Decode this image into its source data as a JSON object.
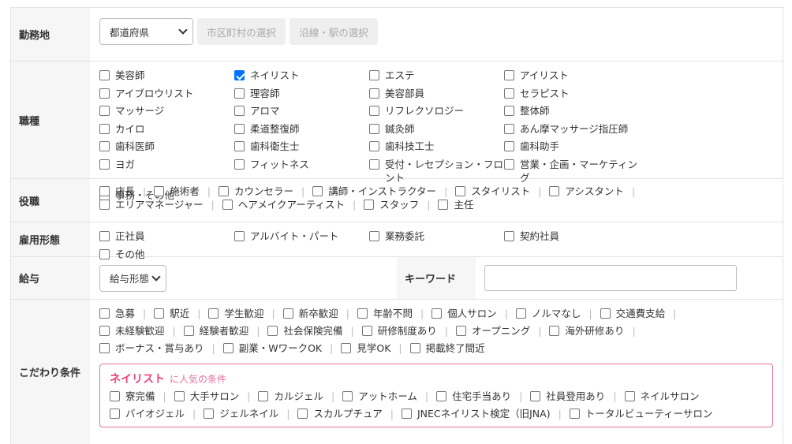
{
  "location": {
    "label": "勤務地",
    "prefecture_select": "都道府県",
    "city_button": "市区町村の選択",
    "station_button": "沿線・駅の選択"
  },
  "occupation": {
    "label": "職種",
    "items": [
      {
        "label": "美容師",
        "checked": false
      },
      {
        "label": "ネイリスト",
        "checked": true
      },
      {
        "label": "エステ",
        "checked": false
      },
      {
        "label": "アイリスト",
        "checked": false
      },
      {
        "label": "アイブロウリスト",
        "checked": false
      },
      {
        "label": "理容師",
        "checked": false
      },
      {
        "label": "美容部員",
        "checked": false
      },
      {
        "label": "セラピスト",
        "checked": false
      },
      {
        "label": "マッサージ",
        "checked": false
      },
      {
        "label": "アロマ",
        "checked": false
      },
      {
        "label": "リフレクソロジー",
        "checked": false
      },
      {
        "label": "整体師",
        "checked": false
      },
      {
        "label": "カイロ",
        "checked": false
      },
      {
        "label": "柔道整復師",
        "checked": false
      },
      {
        "label": "鍼灸師",
        "checked": false
      },
      {
        "label": "あん摩マッサージ指圧師",
        "checked": false
      },
      {
        "label": "歯科医師",
        "checked": false
      },
      {
        "label": "歯科衛生士",
        "checked": false
      },
      {
        "label": "歯科技工士",
        "checked": false
      },
      {
        "label": "歯科助手",
        "checked": false
      },
      {
        "label": "ヨガ",
        "checked": false
      },
      {
        "label": "フィットネス",
        "checked": false
      },
      {
        "label": "受付・レセプション・フロント",
        "checked": false
      },
      {
        "label": "営業・企画・マーケティング",
        "checked": false
      },
      {
        "label": "事務・その他",
        "checked": false
      }
    ]
  },
  "position": {
    "label": "役職",
    "line1": [
      "店長",
      "施術者",
      "カウンセラー",
      "講師・インストラクター",
      "スタイリスト",
      "アシスタント"
    ],
    "line2": [
      "エリアマネージャー",
      "ヘアメイクアーティスト",
      "スタッフ",
      "主任"
    ]
  },
  "employment": {
    "label": "雇用形態",
    "items": [
      "正社員",
      "アルバイト・パート",
      "業務委託",
      "契約社員",
      "その他"
    ]
  },
  "salary": {
    "label": "給与",
    "select": "給与形態",
    "keyword_label": "キーワード",
    "keyword_value": ""
  },
  "conditions": {
    "label": "こだわり条件",
    "line1": [
      "急募",
      "駅近",
      "学生歓迎",
      "新卒歓迎",
      "年齢不問",
      "個人サロン",
      "ノルマなし",
      "交通費支給"
    ],
    "line2": [
      "未経験歓迎",
      "経験者歓迎",
      "社会保険完備",
      "研修制度あり",
      "オープニング",
      "海外研修あり"
    ],
    "line3": [
      "ボーナス・賞与あり",
      "副業・WワークOK",
      "見学OK",
      "掲載終了間近"
    ],
    "popular": {
      "title": "ネイリスト",
      "subtitle": "に人気の条件",
      "line1": [
        "寮完備",
        "大手サロン",
        "カルジェル",
        "アットホーム",
        "住宅手当あり",
        "社員登用あり",
        "ネイルサロン"
      ],
      "line2": [
        "バイオジェル",
        "ジェルネイル",
        "スカルプチュア",
        "JNECネイリスト検定（旧JNA)",
        "トータルビューティーサロン"
      ]
    }
  }
}
